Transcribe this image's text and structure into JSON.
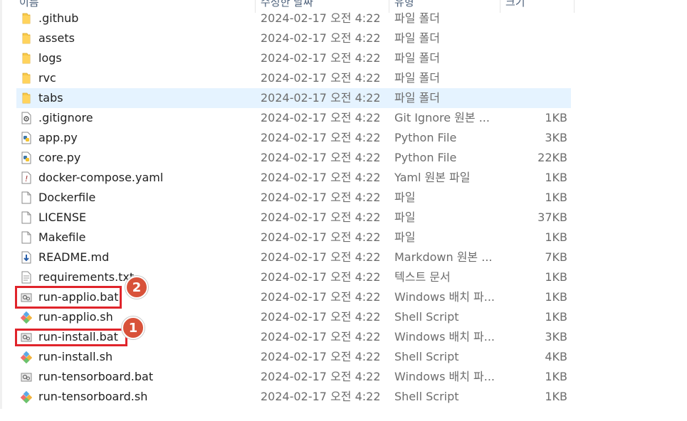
{
  "columns": {
    "name": "이름",
    "date": "수정한 날짜",
    "type": "유형",
    "size": "크기"
  },
  "files": [
    {
      "name": ".github",
      "date": "2024-02-17 오전 4:22",
      "type": "파일 폴더",
      "size": "",
      "icon": "folder-icon"
    },
    {
      "name": "assets",
      "date": "2024-02-17 오전 4:22",
      "type": "파일 폴더",
      "size": "",
      "icon": "folder-icon"
    },
    {
      "name": "logs",
      "date": "2024-02-17 오전 4:22",
      "type": "파일 폴더",
      "size": "",
      "icon": "folder-icon"
    },
    {
      "name": "rvc",
      "date": "2024-02-17 오전 4:22",
      "type": "파일 폴더",
      "size": "",
      "icon": "folder-icon"
    },
    {
      "name": "tabs",
      "date": "2024-02-17 오전 4:22",
      "type": "파일 폴더",
      "size": "",
      "icon": "folder-icon",
      "selected": true
    },
    {
      "name": ".gitignore",
      "date": "2024-02-17 오전 4:22",
      "type": "Git Ignore 원본 ...",
      "size": "1KB",
      "icon": "config-file-icon"
    },
    {
      "name": "app.py",
      "date": "2024-02-17 오전 4:22",
      "type": "Python File",
      "size": "3KB",
      "icon": "python-file-icon"
    },
    {
      "name": "core.py",
      "date": "2024-02-17 오전 4:22",
      "type": "Python File",
      "size": "22KB",
      "icon": "python-file-icon"
    },
    {
      "name": "docker-compose.yaml",
      "date": "2024-02-17 오전 4:22",
      "type": "Yaml 원본 파일",
      "size": "1KB",
      "icon": "yaml-file-icon"
    },
    {
      "name": "Dockerfile",
      "date": "2024-02-17 오전 4:22",
      "type": "파일",
      "size": "1KB",
      "icon": "blank-file-icon"
    },
    {
      "name": "LICENSE",
      "date": "2024-02-17 오전 4:22",
      "type": "파일",
      "size": "37KB",
      "icon": "blank-file-icon"
    },
    {
      "name": "Makefile",
      "date": "2024-02-17 오전 4:22",
      "type": "파일",
      "size": "1KB",
      "icon": "blank-file-icon"
    },
    {
      "name": "README.md",
      "date": "2024-02-17 오전 4:22",
      "type": "Markdown 원본 ...",
      "size": "7KB",
      "icon": "markdown-file-icon"
    },
    {
      "name": "requirements.txt",
      "date": "2024-02-17 오전 4:22",
      "type": "텍스트 문서",
      "size": "1KB",
      "icon": "text-file-icon"
    },
    {
      "name": "run-applio.bat",
      "date": "2024-02-17 오전 4:22",
      "type": "Windows 배치 파...",
      "size": "1KB",
      "icon": "batch-file-icon"
    },
    {
      "name": "run-applio.sh",
      "date": "2024-02-17 오전 4:22",
      "type": "Shell Script",
      "size": "1KB",
      "icon": "shell-script-icon"
    },
    {
      "name": "run-install.bat",
      "date": "2024-02-17 오전 4:22",
      "type": "Windows 배치 파...",
      "size": "3KB",
      "icon": "batch-file-icon"
    },
    {
      "name": "run-install.sh",
      "date": "2024-02-17 오전 4:22",
      "type": "Shell Script",
      "size": "4KB",
      "icon": "shell-script-icon"
    },
    {
      "name": "run-tensorboard.bat",
      "date": "2024-02-17 오전 4:22",
      "type": "Windows 배치 파...",
      "size": "1KB",
      "icon": "batch-file-icon"
    },
    {
      "name": "run-tensorboard.sh",
      "date": "2024-02-17 오전 4:22",
      "type": "Shell Script",
      "size": "1KB",
      "icon": "shell-script-icon"
    }
  ],
  "annotations": [
    {
      "label": "2",
      "target": "run-applio.bat",
      "color": "#e0242b",
      "badge_color": "#d8523a"
    },
    {
      "label": "1",
      "target": "run-install.bat",
      "color": "#e0242b",
      "badge_color": "#d8523a"
    }
  ],
  "colors": {
    "selected_row": "#e5f3ff",
    "header_text": "#4c607a",
    "secondary_text": "#6d6d6d"
  }
}
